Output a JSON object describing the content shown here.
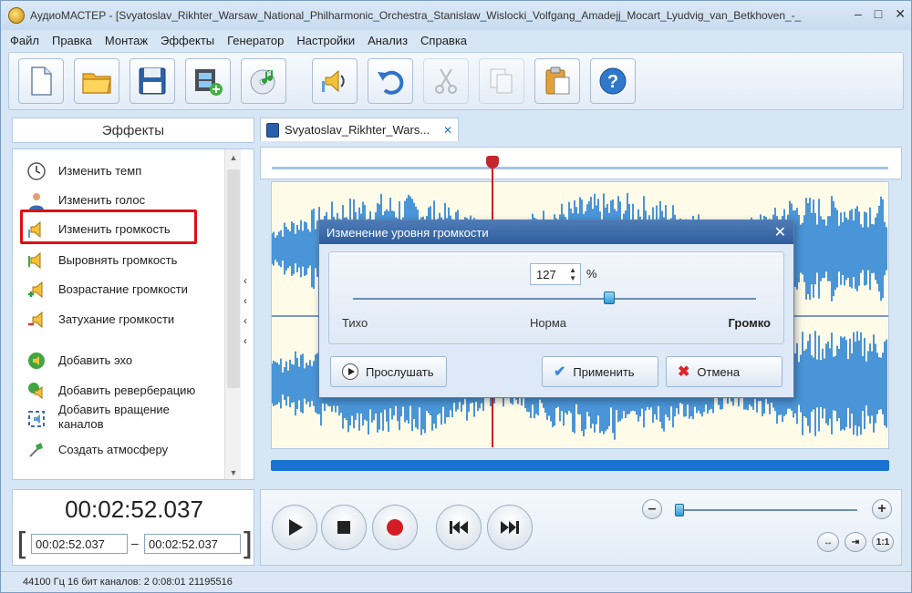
{
  "window": {
    "title": "АудиоМАСТЕР - [Svyatoslav_Rikhter_Warsaw_National_Philharmonic_Orchestra_Stanislaw_Wislocki_Volfgang_Amadejj_Mocart_Lyudvig_van_Betkhoven_-_",
    "controls": {
      "minimize": "–",
      "maximize": "□",
      "close": "✕"
    }
  },
  "menu": [
    "Файл",
    "Правка",
    "Монтаж",
    "Эффекты",
    "Генератор",
    "Настройки",
    "Анализ",
    "Справка"
  ],
  "toolbar": {
    "buttons": [
      {
        "name": "new-file",
        "icon": "new-document-icon"
      },
      {
        "name": "open-file",
        "icon": "folder-icon"
      },
      {
        "name": "save-file",
        "icon": "floppy-icon"
      },
      {
        "name": "add-video",
        "icon": "film-add-icon"
      },
      {
        "name": "cd-import",
        "icon": "cd-music-icon"
      },
      {
        "name": "volume",
        "icon": "speaker-volume-icon"
      },
      {
        "name": "undo",
        "icon": "undo-icon"
      },
      {
        "name": "cut",
        "icon": "scissors-icon",
        "disabled": true
      },
      {
        "name": "copy",
        "icon": "copy-icon",
        "disabled": true
      },
      {
        "name": "paste",
        "icon": "paste-icon"
      },
      {
        "name": "help",
        "icon": "help-icon"
      }
    ]
  },
  "effects": {
    "header": "Эффекты",
    "items": [
      {
        "label": "Изменить темп",
        "icon": "clock-icon"
      },
      {
        "label": "Изменить голос",
        "icon": "person-icon"
      },
      {
        "label": "Изменить громкость",
        "icon": "volume-icon",
        "highlighted": true
      },
      {
        "label": "Выровнять громкость",
        "icon": "equalize-volume-icon"
      },
      {
        "label": "Возрастание громкости",
        "icon": "fade-in-icon"
      },
      {
        "label": "Затухание громкости",
        "icon": "fade-out-icon"
      },
      {
        "label": "Добавить эхо",
        "icon": "echo-icon"
      },
      {
        "label": "Добавить реверберацию",
        "icon": "reverb-icon"
      },
      {
        "label": "Добавить вращение каналов",
        "icon": "channel-rotate-icon"
      },
      {
        "label": "Создать атмосферу",
        "icon": "atmosphere-icon"
      }
    ]
  },
  "tab": {
    "label": "Svyatoslav_Rikhter_Wars...",
    "close": "✕"
  },
  "dialog": {
    "title": "Изменение уровня громкости",
    "close": "✕",
    "value": "127",
    "unit": "%",
    "level": 0.635,
    "labels": {
      "quiet": "Тихо",
      "norm": "Норма",
      "loud": "Громко"
    },
    "buttons": {
      "listen": "Прослушать",
      "apply": "Применить",
      "cancel": "Отмена"
    },
    "colors": {
      "title_bg": "#2f5e9e",
      "cancel_icon": "#d9262c",
      "apply_icon": "#3b8ad8"
    }
  },
  "time": {
    "current": "00:02:52.037",
    "start": "00:02:52.037",
    "end": "00:02:52.037",
    "separator": "–",
    "bracket_open": "[",
    "bracket_close": "]"
  },
  "transport": {
    "zoom_minus": "–",
    "zoom_plus": "+",
    "fit": "↔",
    "fit_selection": "⇥",
    "one_to_one": "1:1"
  },
  "status": {
    "text": "44100 Гц  16 бит  каналов: 2  0:08:01 21195516"
  },
  "colors": {
    "waveform": "#4a95d8",
    "playhead": "#d21d25",
    "highlight": "#e01010",
    "scrollbar": "#1a73d1"
  }
}
